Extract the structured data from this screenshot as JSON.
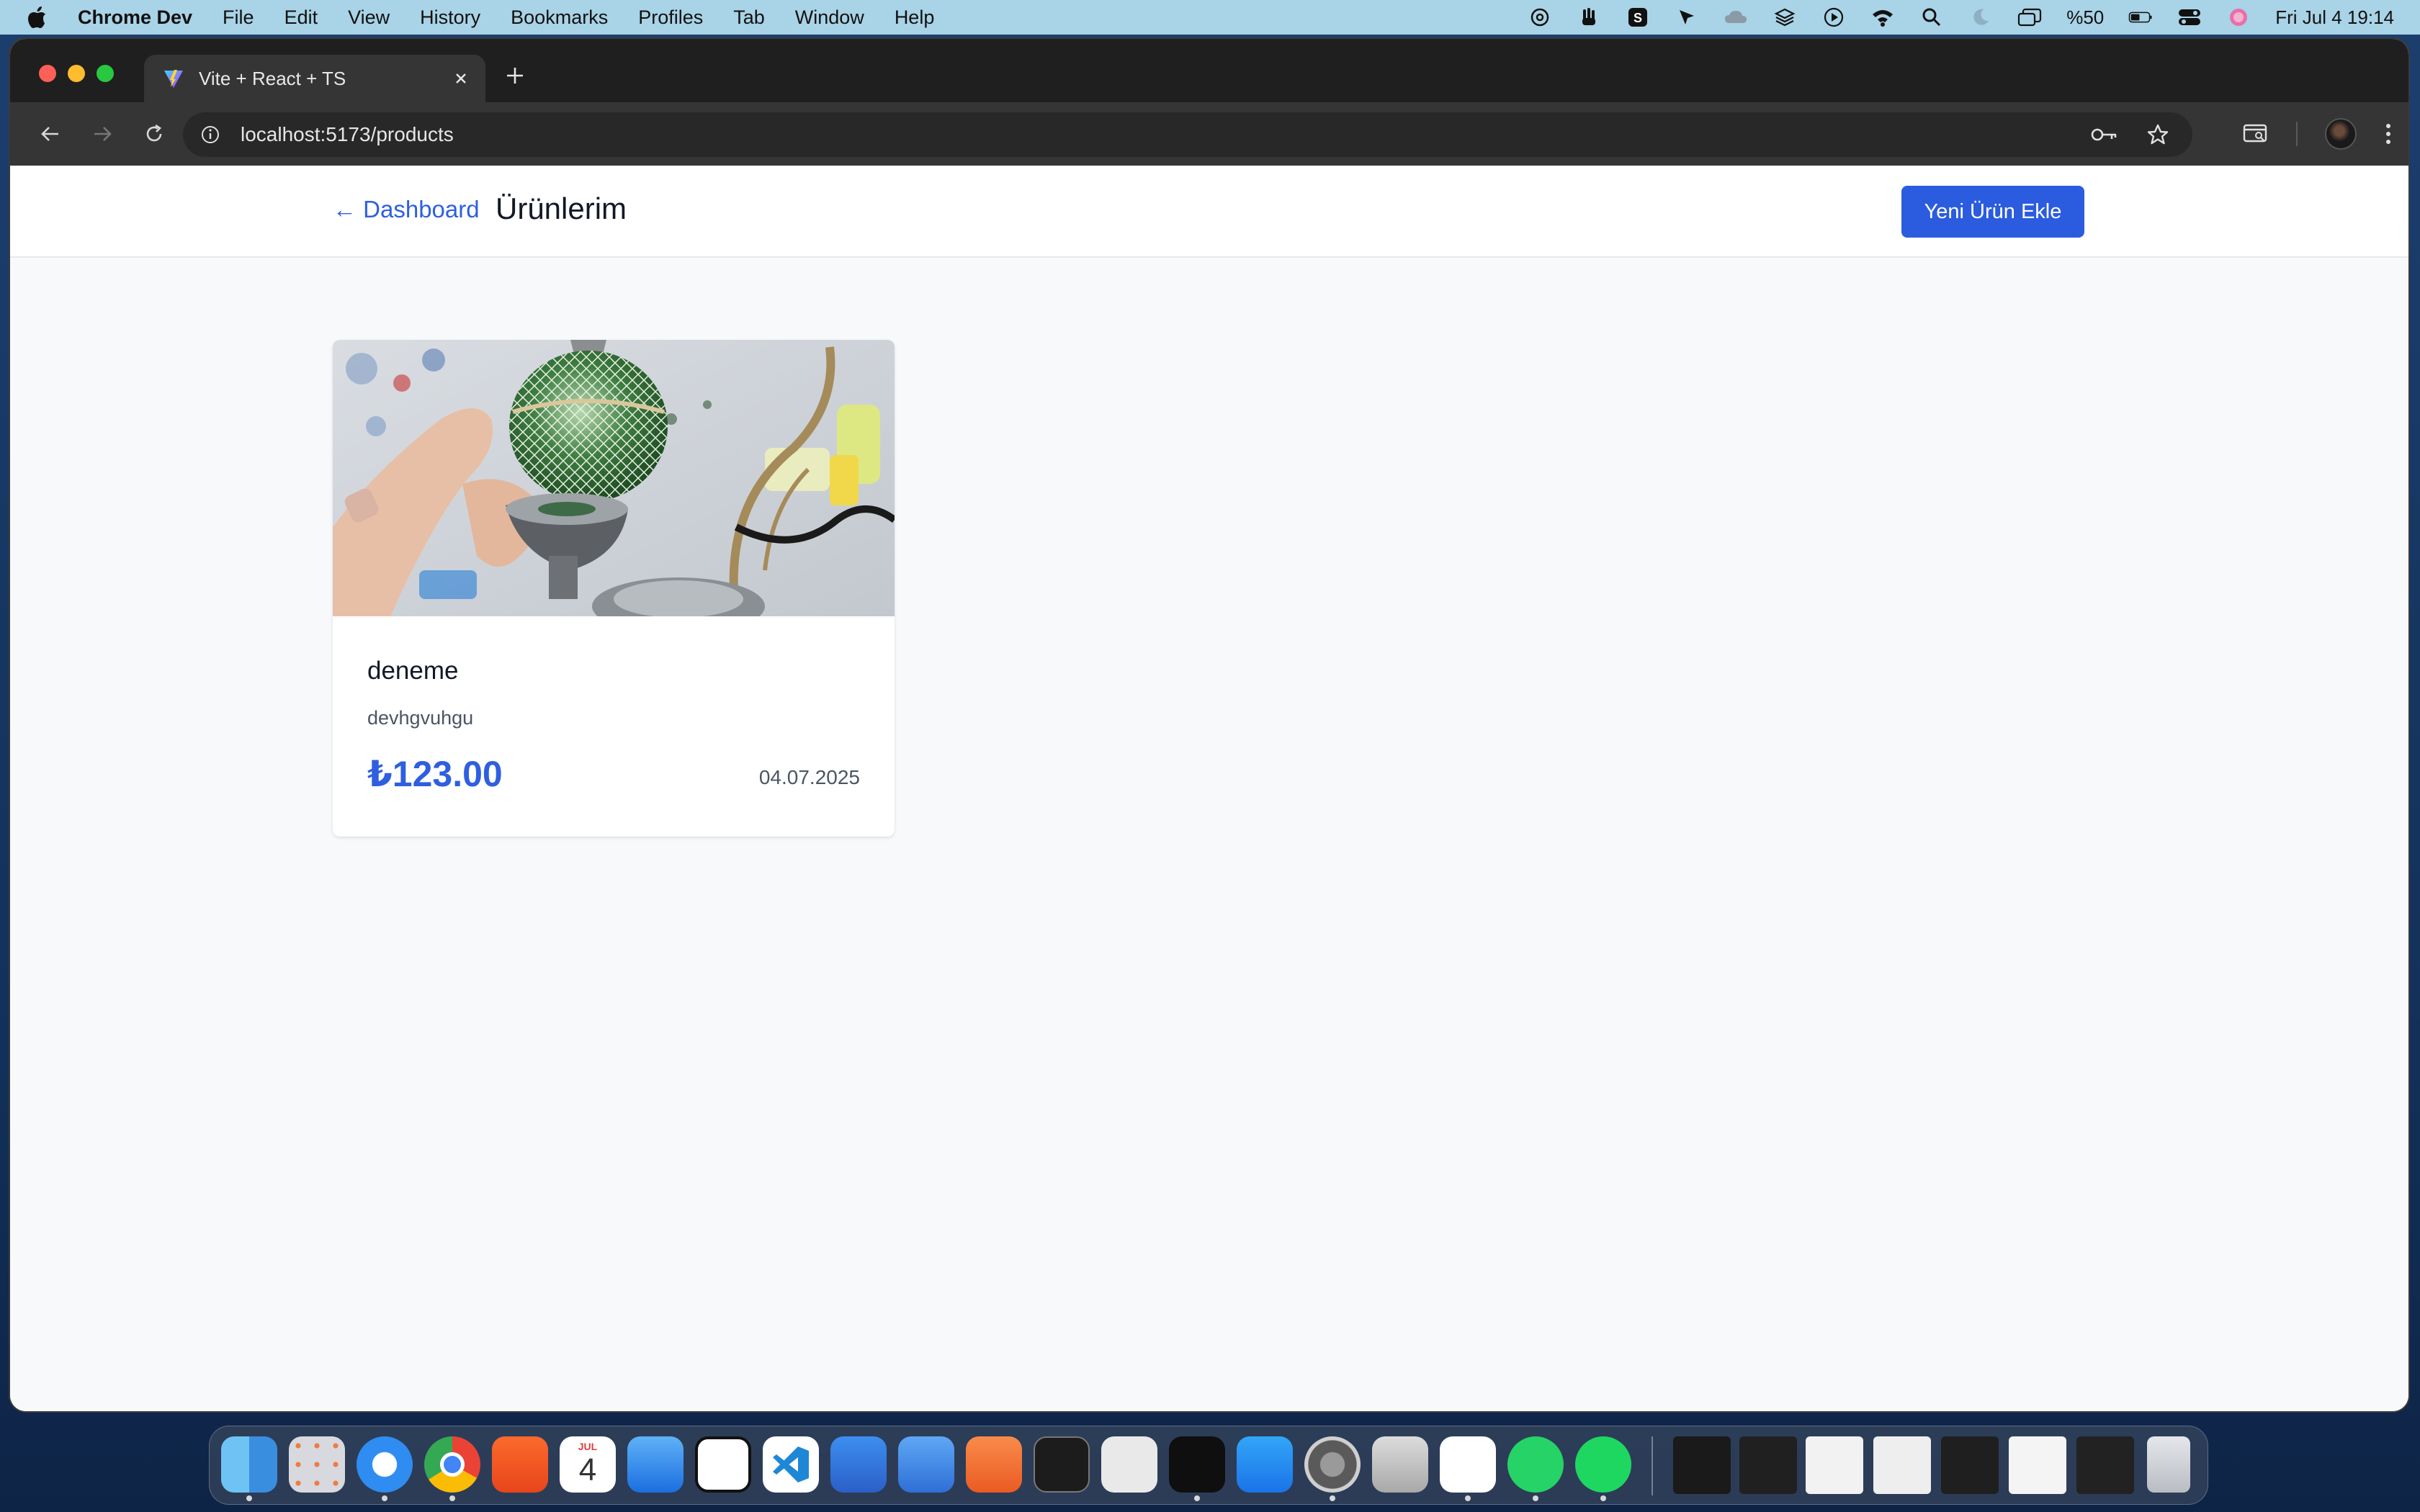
{
  "menubar": {
    "app_name": "Chrome Dev",
    "items": [
      "File",
      "Edit",
      "View",
      "History",
      "Bookmarks",
      "Profiles",
      "Tab",
      "Window",
      "Help"
    ],
    "battery_text": "%50",
    "datetime": "Fri Jul 4  19:14"
  },
  "browser": {
    "tab_title": "Vite + React + TS",
    "url": "localhost:5173/products"
  },
  "page": {
    "back_link": "← Dashboard",
    "title": "Ürünlerim",
    "add_button": "Yeni Ürün Ekle",
    "products": [
      {
        "name": "deneme",
        "description": "devhgvuhgu",
        "price": "₺123.00",
        "date": "04.07.2025"
      }
    ]
  },
  "colors": {
    "accent": "#2b5ce0",
    "link": "#2f5fdf",
    "menubar": "#a9d3e6",
    "browser_chrome": "#353535"
  },
  "dock": {
    "apps": [
      "finder-icon",
      "launchpad-icon",
      "safari-icon",
      "chrome-icon",
      "brave-icon",
      "calendar-icon",
      "mail-icon",
      "notion-icon",
      "vscode-icon",
      "xcode-icon",
      "simulator-icon",
      "instruments-icon",
      "terminal-icon",
      "readdle-icon",
      "cursor-icon",
      "app-store-icon",
      "system-settings-icon",
      "iphone-mirroring-icon",
      "chatgpt-icon",
      "whatsapp-icon",
      "spotify-icon"
    ],
    "calendar_month": "JUL",
    "calendar_day": "4"
  }
}
